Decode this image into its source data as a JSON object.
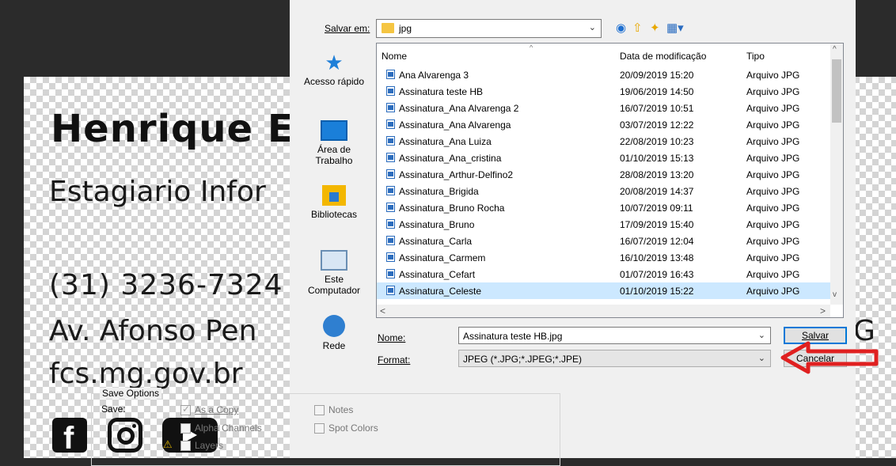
{
  "signature": {
    "name": "Henrique E",
    "role": "Estagiario Infor",
    "phone": "(31) 3236-7324",
    "address": "Av. Afonso Pen",
    "address_tail": "G",
    "website": "fcs.mg.gov.br",
    "social_icons": [
      "facebook-icon",
      "instagram-icon",
      "youtube-icon"
    ]
  },
  "dialog": {
    "save_in_label": "Salvar em:",
    "save_in_value": "jpg",
    "places": [
      {
        "label": "Acesso rápido",
        "icon": "star-icon"
      },
      {
        "label": "Área de Trabalho",
        "icon": "desktop-icon"
      },
      {
        "label": "Bibliotecas",
        "icon": "libraries-icon"
      },
      {
        "label": "Este Computador",
        "icon": "computer-icon"
      },
      {
        "label": "Rede",
        "icon": "network-icon"
      }
    ],
    "columns": {
      "name": "Nome",
      "date": "Data de modificação",
      "type": "Tipo"
    },
    "files": [
      {
        "name": "Ana Alvarenga 3",
        "date": "20/09/2019 15:20",
        "type": "Arquivo JPG"
      },
      {
        "name": "Assinatura teste HB",
        "date": "19/06/2019 14:50",
        "type": "Arquivo JPG"
      },
      {
        "name": "Assinatura_Ana Alvarenga 2",
        "date": "16/07/2019 10:51",
        "type": "Arquivo JPG"
      },
      {
        "name": "Assinatura_Ana Alvarenga",
        "date": "03/07/2019 12:22",
        "type": "Arquivo JPG"
      },
      {
        "name": "Assinatura_Ana Luiza",
        "date": "22/08/2019 10:23",
        "type": "Arquivo JPG"
      },
      {
        "name": "Assinatura_Ana_cristina",
        "date": "01/10/2019 15:13",
        "type": "Arquivo JPG"
      },
      {
        "name": "Assinatura_Arthur-Delfino2",
        "date": "28/08/2019 13:20",
        "type": "Arquivo JPG"
      },
      {
        "name": "Assinatura_Brigida",
        "date": "20/08/2019 14:37",
        "type": "Arquivo JPG"
      },
      {
        "name": "Assinatura_Bruno Rocha",
        "date": "10/07/2019 09:11",
        "type": "Arquivo JPG"
      },
      {
        "name": "Assinatura_Bruno",
        "date": "17/09/2019 15:40",
        "type": "Arquivo JPG"
      },
      {
        "name": "Assinatura_Carla",
        "date": "16/07/2019 12:04",
        "type": "Arquivo JPG"
      },
      {
        "name": "Assinatura_Carmem",
        "date": "16/10/2019 13:48",
        "type": "Arquivo JPG"
      },
      {
        "name": "Assinatura_Cefart",
        "date": "01/07/2019 16:43",
        "type": "Arquivo JPG"
      },
      {
        "name": "Assinatura_Celeste",
        "date": "01/10/2019 15:22",
        "type": "Arquivo JPG",
        "selected": true
      }
    ],
    "filename_label": "Nome:",
    "filename_value": "Assinatura teste HB.jpg",
    "format_label": "Format:",
    "format_value": "JPEG (*.JPG;*.JPEG;*.JPE)",
    "save_button": "Salvar",
    "cancel_button": "Cancelar",
    "save_options": {
      "title": "Save Options",
      "save_label": "Save:",
      "as_a_copy": "As a Copy",
      "alpha_channels": "Alpha Channels",
      "layers": "Layers",
      "notes": "Notes",
      "spot_colors": "Spot Colors"
    }
  },
  "colors": {
    "selection": "#cce8ff",
    "default_button_border": "#0078d7",
    "annotation_arrow": "#e02020"
  }
}
